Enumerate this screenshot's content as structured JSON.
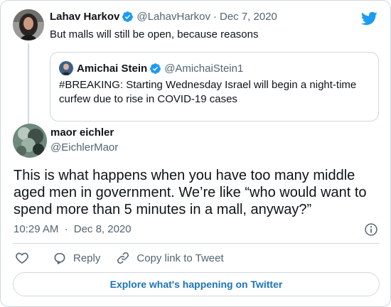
{
  "colors": {
    "twitter_blue": "#1d9bf0",
    "link_blue": "#1d74b8",
    "text_primary": "#0f1419",
    "text_secondary": "#536471",
    "border": "#cfd9de"
  },
  "parent_tweet": {
    "author_name": "Lahav Harkov",
    "author_handle": "@LahavHarkov",
    "separator": "·",
    "date": "Dec 7, 2020",
    "verified": true,
    "text": "But malls will still be open, because reasons",
    "quoted_tweet": {
      "author_name": "Amichai Stein",
      "author_handle": "@AmichaiStein1",
      "verified": true,
      "text": "#BREAKING: Starting Wednesday Israel will begin a night-time curfew due to rise in COVID-19 cases"
    }
  },
  "main_tweet": {
    "author_name": "maor eichler",
    "author_handle": "@EichlerMaor",
    "text": "This is what happens when you have too many middle aged men in government. We’re like “who would want to spend more than 5 minutes in a mall, anyway?”",
    "time": "10:29 AM",
    "separator": "·",
    "date": "Dec 8, 2020"
  },
  "actions": {
    "like_icon": "heart-icon",
    "reply_label": "Reply",
    "copy_link_label": "Copy link to Tweet"
  },
  "explore_label": "Explore what's happening on Twitter",
  "icons": {
    "logo": "twitter-bird-icon",
    "info": "info-icon",
    "verified": "verified-badge-icon"
  }
}
